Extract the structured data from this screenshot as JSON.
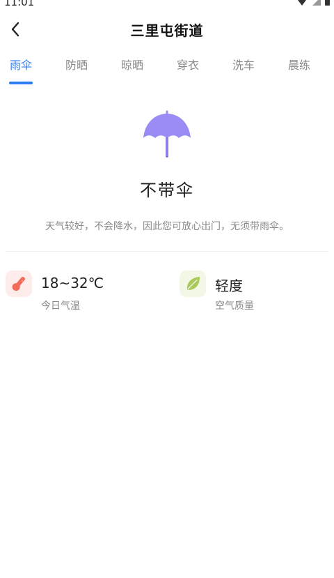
{
  "status_bar": {
    "time": "11:01"
  },
  "header": {
    "title": "三里屯街道"
  },
  "tabs": [
    {
      "label": "雨伞",
      "active": true
    },
    {
      "label": "防晒",
      "active": false
    },
    {
      "label": "晾晒",
      "active": false
    },
    {
      "label": "穿衣",
      "active": false
    },
    {
      "label": "洗车",
      "active": false
    },
    {
      "label": "晨练",
      "active": false
    }
  ],
  "main": {
    "icon": "umbrella-icon",
    "title": "不带伞",
    "advice": "天气较好，不会降水，因此您可放心出门，无须带雨伞。"
  },
  "info": {
    "temperature": {
      "value": "18~32℃",
      "label": "今日气温",
      "icon": "thermometer-icon"
    },
    "air_quality": {
      "value": "轻度",
      "label": "空气质量",
      "icon": "leaf-icon"
    }
  },
  "colors": {
    "accent": "#2e7cf6",
    "umbrella": "#9a8cf5",
    "temperature_icon": "#f26b5b",
    "leaf_icon": "#a9c95a"
  }
}
